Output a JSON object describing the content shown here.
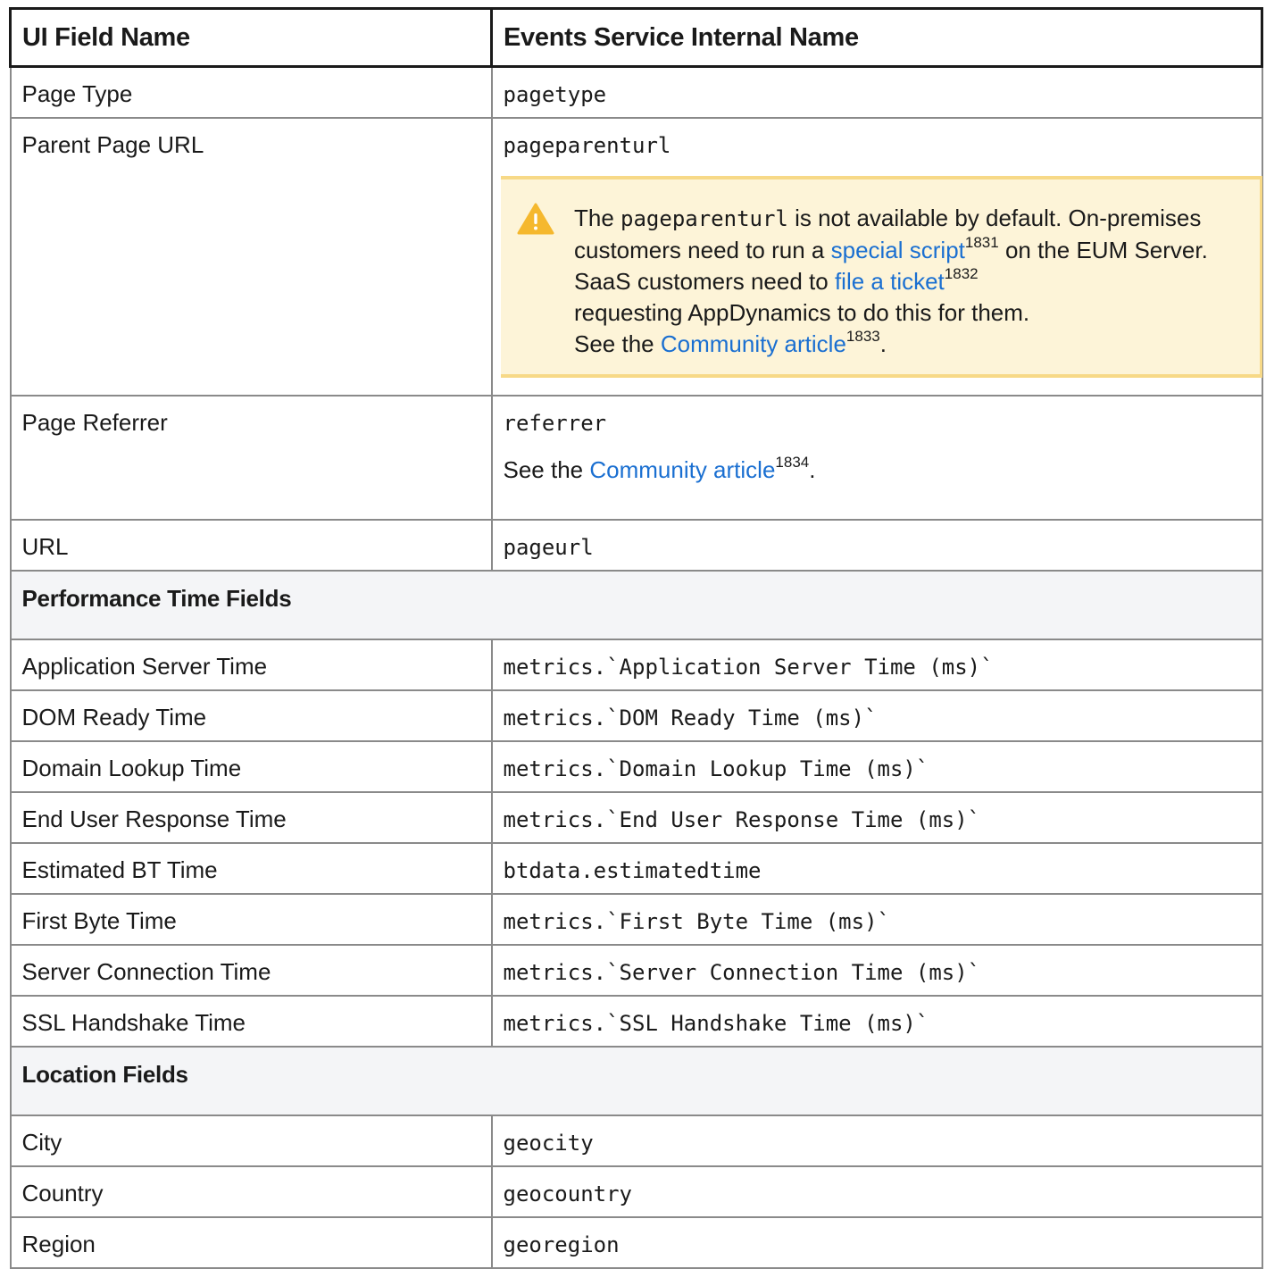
{
  "header": {
    "col1": "UI Field Name",
    "col2": "Events Service Internal Name"
  },
  "rows_top": [
    {
      "label": "Page Type",
      "value": "pagetype"
    },
    {
      "label": "Parent Page URL",
      "value": "pageparenturl"
    },
    {
      "label": "Page Referrer",
      "value": "referrer"
    },
    {
      "label": "URL",
      "value": "pageurl"
    }
  ],
  "warning": {
    "icon": "warning-triangle-icon",
    "t1": "The ",
    "code": "pageparenturl",
    "t2": " is not available by default. On-premises customers need to run a ",
    "link1": "special script",
    "sup1": "1831",
    "t3": " on the EUM Server. SaaS customers need to ",
    "link2": "file a ticket",
    "sup2": "1832",
    "t4": " requesting AppDynamics to do this for them.",
    "t5": "See the ",
    "link3": "Community article",
    "sup3": "1833",
    "t6": "."
  },
  "referrer_note": {
    "prefix": "See the ",
    "link": "Community article",
    "sup": "1834",
    "suffix": "."
  },
  "sections": [
    {
      "title": "Performance Time Fields",
      "rows": [
        {
          "label": "Application Server Time",
          "value": "metrics.`Application Server Time (ms)`"
        },
        {
          "label": "DOM Ready Time",
          "value": "metrics.`DOM Ready Time (ms)`"
        },
        {
          "label": "Domain Lookup Time",
          "value": "metrics.`Domain Lookup Time (ms)`"
        },
        {
          "label": "End User Response Time",
          "value": "metrics.`End User Response Time (ms)`"
        },
        {
          "label": "Estimated BT Time",
          "value": "btdata.estimatedtime"
        },
        {
          "label": "First Byte Time",
          "value": "metrics.`First Byte Time (ms)`"
        },
        {
          "label": "Server Connection Time",
          "value": "metrics.`Server Connection Time (ms)`"
        },
        {
          "label": "SSL Handshake Time",
          "value": "metrics.`SSL Handshake Time (ms)`"
        }
      ]
    },
    {
      "title": "Location Fields",
      "rows": [
        {
          "label": "City",
          "value": "geocity"
        },
        {
          "label": "Country",
          "value": "geocountry"
        },
        {
          "label": "Region",
          "value": "georegion"
        }
      ]
    }
  ],
  "colors": {
    "link": "#1a6fd1",
    "warning_bg": "#fdf4d8",
    "warning_border": "#f7d987",
    "warning_icon": "#f5b82e",
    "section_bg": "#f4f5f7"
  }
}
